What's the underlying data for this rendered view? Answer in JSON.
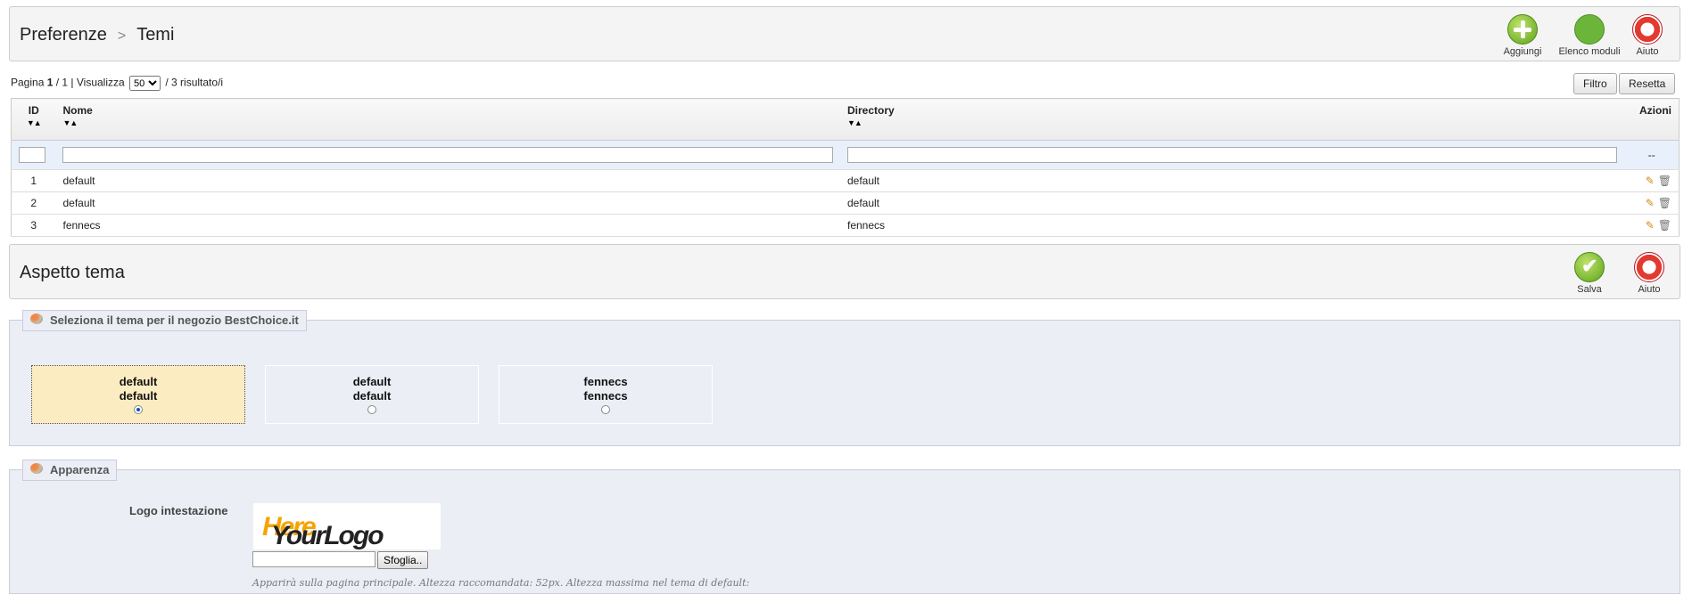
{
  "header": {
    "breadcrumb_parent": "Preferenze",
    "breadcrumb_separator": ">",
    "breadcrumb_current": "Temi",
    "buttons": [
      {
        "label": "Aggiungi",
        "icon": "add-icon"
      },
      {
        "label": "Elenco moduli",
        "icon": "puzzle-icon"
      },
      {
        "label": "Aiuto",
        "icon": "lifebuoy-icon"
      }
    ]
  },
  "pager": {
    "page_label": "Pagina",
    "page_current": "1",
    "page_total_text": "/ 1 | Visualizza",
    "per_page": "50",
    "results_text": "/ 3 risultato/i",
    "filter_label": "Filtro",
    "reset_label": "Resetta"
  },
  "table": {
    "columns": [
      "ID",
      "Nome",
      "Directory",
      "Azioni"
    ],
    "sort_arrows": "▼▲",
    "filter_actions_placeholder": "--",
    "rows": [
      {
        "id": "1",
        "name": "default",
        "directory": "default"
      },
      {
        "id": "2",
        "name": "default",
        "directory": "default"
      },
      {
        "id": "3",
        "name": "fennecs",
        "directory": "fennecs"
      }
    ]
  },
  "appearance_header": {
    "title": "Aspetto tema",
    "buttons": [
      {
        "label": "Salva",
        "icon": "save-check-icon"
      },
      {
        "label": "Aiuto",
        "icon": "lifebuoy-icon"
      }
    ]
  },
  "theme_select": {
    "legend": "Seleziona il tema per il negozio BestChoice.it",
    "themes": [
      {
        "line1": "default",
        "line2": "default",
        "selected": true
      },
      {
        "line1": "default",
        "line2": "default",
        "selected": false
      },
      {
        "line1": "fennecs",
        "line2": "fennecs",
        "selected": false
      }
    ]
  },
  "appearance": {
    "legend": "Apparenza",
    "logo_label": "Logo intestazione",
    "logo_text_main": "YourLogo",
    "logo_text_accent": "Here",
    "browse_label": "Sfoglia..",
    "note": "Apparirà sulla pagina principale. Altezza raccomandata: 52px. Altezza massima nel tema di default:"
  }
}
